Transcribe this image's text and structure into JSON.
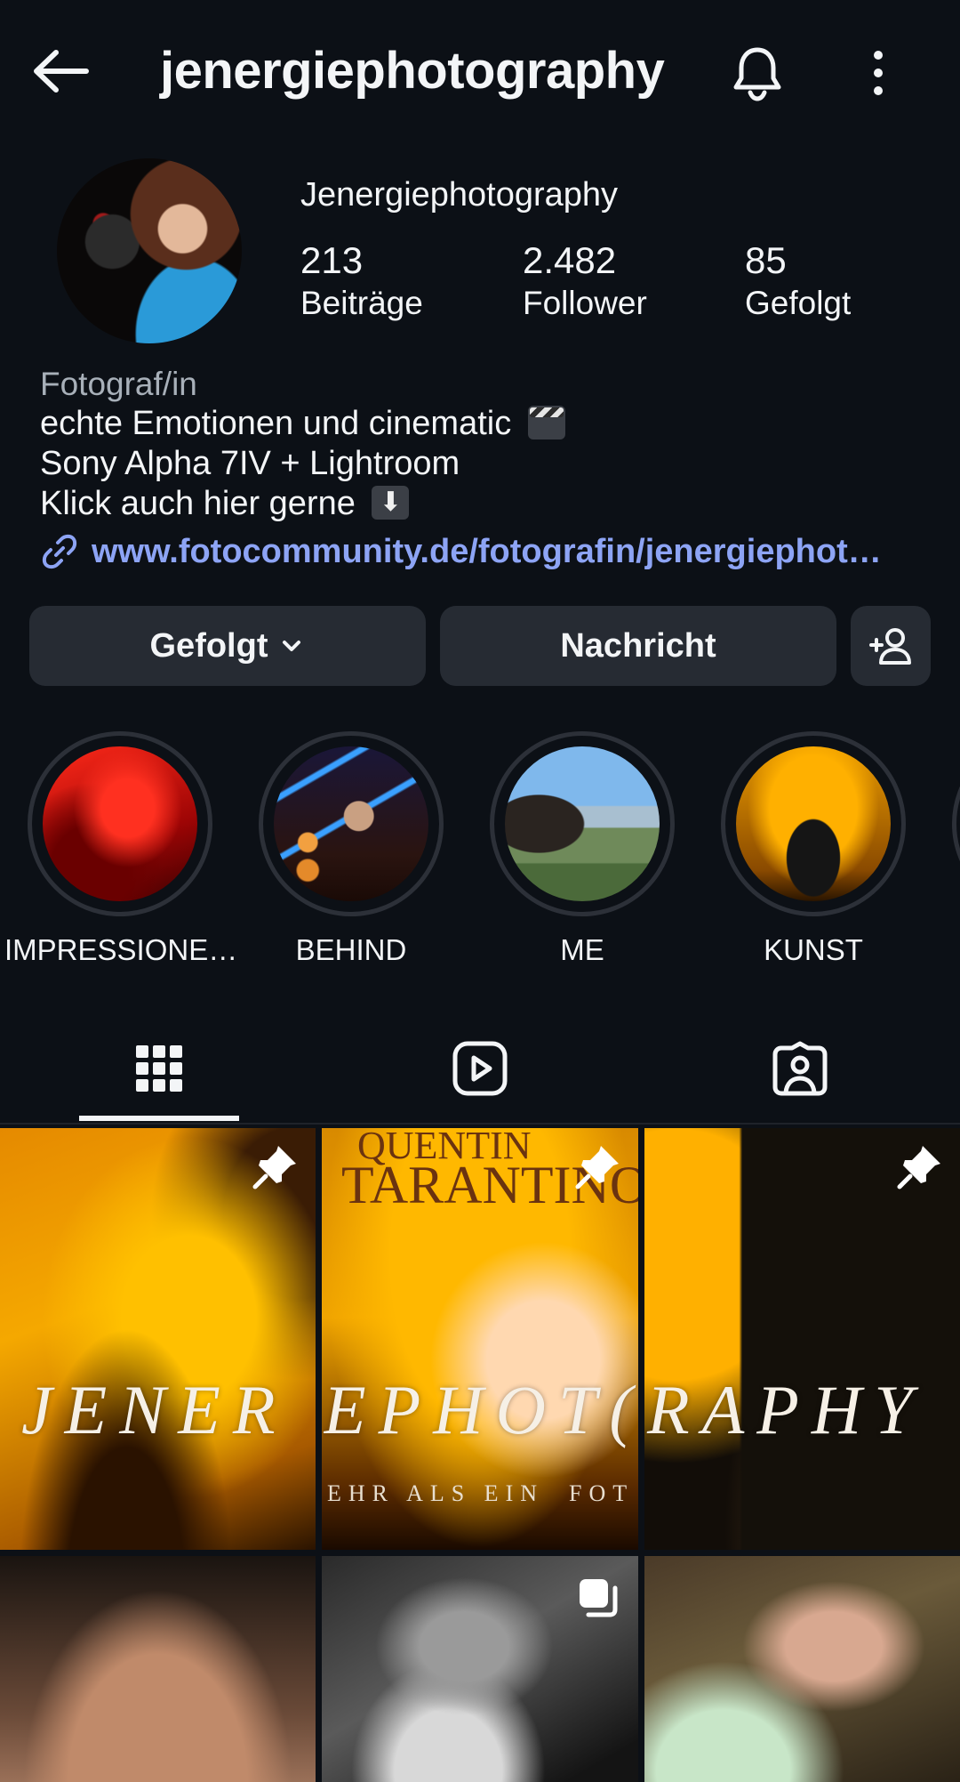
{
  "header": {
    "username": "jenergiephotography"
  },
  "profile": {
    "display_name": "Jenergiephotography",
    "stats": [
      {
        "value": "213",
        "label": "Beiträge"
      },
      {
        "value": "2.482",
        "label": "Follower"
      },
      {
        "value": "85",
        "label": "Gefolgt"
      }
    ]
  },
  "bio": {
    "category": "Fotograf/in",
    "lines": [
      "echte Emotionen und cinematic",
      "Sony Alpha 7IV + Lightroom",
      "Klick auch hier gerne"
    ],
    "link": "www.fotocommunity.de/fotografin/jenergiephot…"
  },
  "actions": {
    "following": "Gefolgt",
    "message": "Nachricht"
  },
  "highlights": [
    {
      "label": "IMPRESSIONE…"
    },
    {
      "label": "BEHIND"
    },
    {
      "label": "ME"
    },
    {
      "label": "KUNST"
    }
  ],
  "posts": {
    "watermark": [
      "JENER",
      "EPHOT(",
      "RAPHY"
    ],
    "subtitle": [
      "EHR ALS EIN",
      "FOT"
    ],
    "poster": [
      "QUENTIN",
      "TARANTINO"
    ]
  },
  "icons": {
    "back": "arrow-left-icon",
    "bell": "bell-icon",
    "more": "more-vertical-icon",
    "link": "link-icon",
    "chevron": "chevron-down-icon",
    "add_person": "add-person-icon",
    "grid": "grid-icon",
    "reels": "reels-icon",
    "tagged": "tagged-icon",
    "pin": "pin-icon",
    "carousel": "carousel-icon"
  },
  "colors": {
    "background": "#0c1016",
    "button": "#262b33",
    "link": "#8da4f5",
    "secondary_text": "#a8b0b9"
  }
}
